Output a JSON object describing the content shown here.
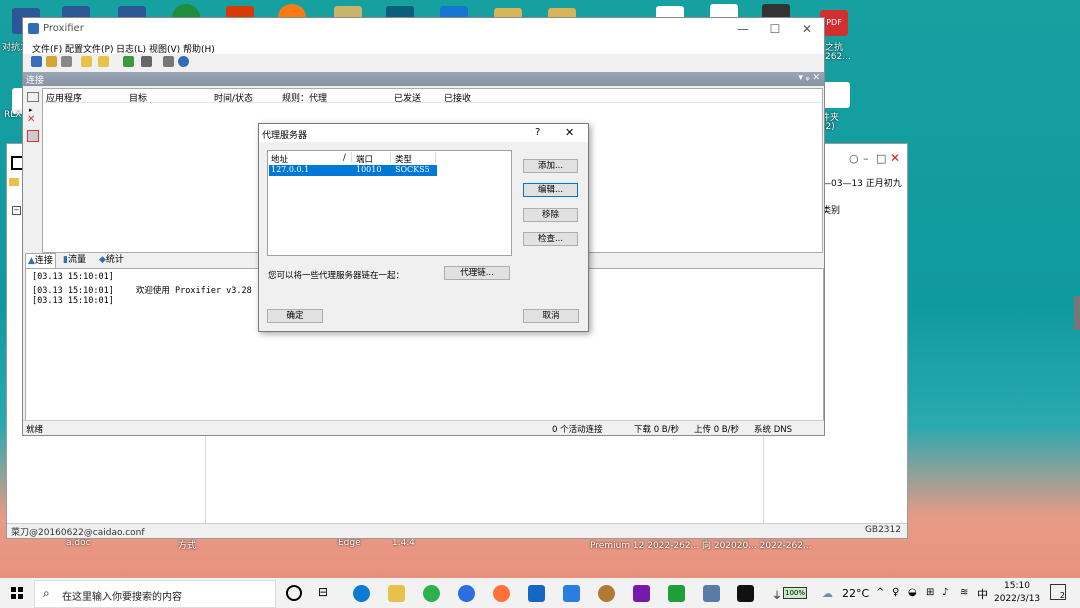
{
  "desktop": {
    "icons": [
      {
        "name": "word-doc-icon",
        "label": "对抗之\n陷",
        "color": "#2b5797"
      },
      {
        "name": "word-doc-2-icon",
        "label": "",
        "color": "#2b5797"
      },
      {
        "name": "word-doc-3-icon",
        "label": "",
        "color": "#2b5797"
      },
      {
        "name": "green-app-icon",
        "label": "",
        "color": "#1e8e3e"
      },
      {
        "name": "chart-app-icon",
        "label": "",
        "color": "#d83b01"
      },
      {
        "name": "orange-app-icon",
        "label": "",
        "color": "#f97b16"
      },
      {
        "name": "file-icon",
        "label": "",
        "color": "#c8b46a"
      },
      {
        "name": "teal-app-icon",
        "label": "",
        "color": "#0a5f7e"
      },
      {
        "name": "blue-app-icon",
        "label": "",
        "color": "#1476d2"
      },
      {
        "name": "folder-icon",
        "label": "",
        "color": "#d7b45a"
      },
      {
        "name": "folder-2-icon",
        "label": "",
        "color": "#d7b45a"
      },
      {
        "name": "doc-white-icon",
        "label": "",
        "color": "#ffffff"
      },
      {
        "name": "doc-plus-icon",
        "label": "",
        "color": "#ffffff"
      },
      {
        "name": "dark-window-icon",
        "label": "",
        "color": "#333333"
      },
      {
        "name": "pdf-icon",
        "label": "PDF",
        "color": "#d32f2f"
      }
    ],
    "left_labels": [
      "对抗之",
      "RLX"
    ],
    "right_labels": [
      "之抗",
      "262...",
      "文件夹",
      "(2)"
    ],
    "bottom_labels": [
      "a.doc",
      "方式",
      "Edge",
      "1.4.4",
      "Premium 12  2022-262...  向 202020...  2022-262..."
    ]
  },
  "bg_window": {
    "controls": {
      "minimize": "○",
      "maximize": "□",
      "close": "✕",
      "dash": "–"
    },
    "date_text": "—03—13  正月初九",
    "side_text_1": "类别",
    "status_left": "菜刀@20160622@caidao.conf",
    "status_right": "GB2312"
  },
  "main_window": {
    "title": "Proxifier",
    "controls": {
      "minimize": "—",
      "maximize": "☐",
      "close": "✕"
    },
    "menu": [
      "文件(F)",
      "配置文件(P)",
      "日志(L)",
      "视图(V)",
      "帮助(H)"
    ],
    "pane_title": "连接",
    "pane_controls": "▾ ᵩ ✕",
    "columns": [
      "应用程序",
      "目标",
      "时间/状态",
      "规则：代理",
      "已发送",
      "已接收"
    ],
    "tabs": [
      {
        "label": "连接",
        "icon": "connections-icon"
      },
      {
        "label": "流量",
        "icon": "traffic-icon"
      },
      {
        "label": "统计",
        "icon": "statistics-icon"
      }
    ],
    "log": [
      {
        "time": "[03.13 15:10:01]",
        "msg": ""
      },
      {
        "time": "[03.13 15:10:01]",
        "msg": "欢迎使用 Proxifier v3.28"
      },
      {
        "time": "[03.13 15:10:01]",
        "msg": ""
      }
    ],
    "status": {
      "ready": "就绪",
      "active": "0 个活动连接",
      "down": "下载 0 B/秒",
      "up": "上传 0 B/秒",
      "dns": "系统 DNS"
    }
  },
  "dialog": {
    "title": "代理服务器",
    "help": "?",
    "close": "✕",
    "columns": [
      "地址",
      "/",
      "端口",
      "类型"
    ],
    "rows": [
      {
        "address": "127.0.0.1",
        "port": "10010",
        "type": "SOCKS5"
      }
    ],
    "buttons": {
      "add": "添加...",
      "edit": "编辑...",
      "remove": "移除",
      "check": "检查..."
    },
    "chain_text": "您可以将一些代理服务器链在一起：",
    "chain_button": "代理链...",
    "ok": "确定",
    "cancel": "取消"
  },
  "taskbar": {
    "search_placeholder": "在这里输入你要搜索的内容",
    "battery": "100%",
    "weather": "22°C",
    "ime": "中",
    "time": "15:10",
    "date": "2022/3/13",
    "notification_count": "2"
  },
  "colors": {
    "selection": "#0078d7",
    "accent": "#0078d7"
  }
}
